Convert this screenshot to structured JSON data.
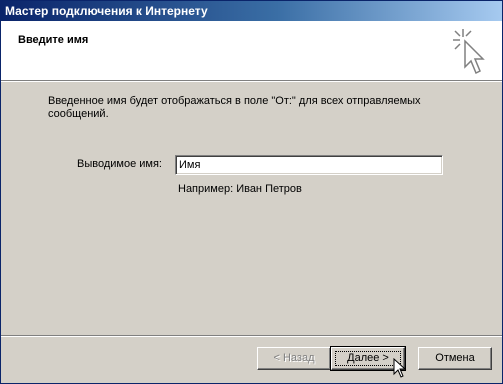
{
  "window": {
    "title": "Мастер подключения к Интернету"
  },
  "header": {
    "heading": "Введите имя",
    "graphic_icon": "wizard-sparkle-cursor-icon"
  },
  "main": {
    "description": "Введенное имя будет отображаться в поле \"От:\" для всех отправляемых сообщений.",
    "display_name_label": "Выводимое имя:",
    "display_name_value": "Имя",
    "example_text": "Например: Иван Петров"
  },
  "buttons": {
    "back_label": "< Назад",
    "next_label": "Далее >",
    "cancel_label": "Отмена"
  },
  "colors": {
    "titlebar_start": "#0a246a",
    "titlebar_end": "#a6caf0",
    "face": "#d4d0c8"
  }
}
